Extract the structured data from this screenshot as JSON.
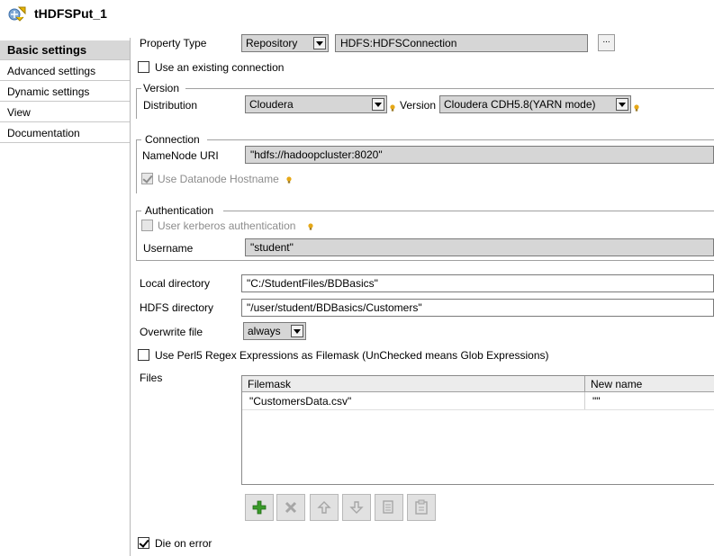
{
  "header": {
    "title": "tHDFSPut_1",
    "icon": "hdfs-component-icon"
  },
  "sidebar": {
    "items": [
      {
        "label": "Basic settings",
        "active": true
      },
      {
        "label": "Advanced settings",
        "active": false
      },
      {
        "label": "Dynamic settings",
        "active": false
      },
      {
        "label": "View",
        "active": false
      },
      {
        "label": "Documentation",
        "active": false
      }
    ]
  },
  "property_type": {
    "label": "Property Type",
    "value": "Repository",
    "repository_value": "HDFS:HDFSConnection",
    "browse_label": "..."
  },
  "use_existing_connection": {
    "label": "Use an existing connection",
    "checked": false
  },
  "version": {
    "group_label": "Version",
    "distribution_label": "Distribution",
    "distribution_value": "Cloudera",
    "version_label": "Version",
    "version_value": "Cloudera CDH5.8(YARN mode)"
  },
  "connection": {
    "group_label": "Connection",
    "namenode_label": "NameNode URI",
    "namenode_value": "\"hdfs://hadoopcluster:8020\"",
    "datanode_hostname_label": "Use Datanode Hostname",
    "datanode_hostname_checked": true
  },
  "authentication": {
    "group_label": "Authentication",
    "kerberos_label": "User kerberos authentication",
    "kerberos_checked": false,
    "username_label": "Username",
    "username_value": "\"student\""
  },
  "local_directory": {
    "label": "Local directory",
    "value": "\"C:/StudentFiles/BDBasics\""
  },
  "hdfs_directory": {
    "label": "HDFS directory",
    "value": "\"/user/student/BDBasics/Customers\""
  },
  "overwrite_file": {
    "label": "Overwrite file",
    "value": "always"
  },
  "perl_regex": {
    "label": "Use Perl5 Regex Expressions as Filemask (UnChecked means Glob Expressions)",
    "checked": false
  },
  "files": {
    "label": "Files",
    "columns": [
      "Filemask",
      "New name"
    ],
    "rows": [
      {
        "filemask": "\"CustomersData.csv\"",
        "new_name": "\"\""
      }
    ],
    "buttons": [
      "add-icon",
      "remove-icon",
      "move-up-icon",
      "move-down-icon",
      "copy-icon",
      "paste-icon"
    ]
  },
  "die_on_error": {
    "label": "Die on error",
    "checked": true
  },
  "colors": {
    "accent_green": "#3a9a2a",
    "bulb": "#e6a817",
    "disabled_field": "#d6d6d6"
  }
}
